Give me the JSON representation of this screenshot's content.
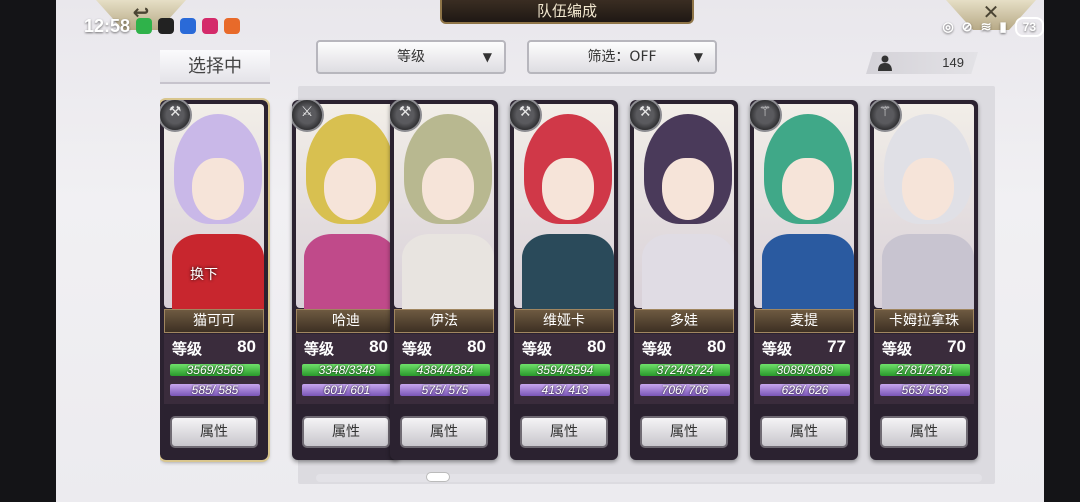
{
  "status_bar": {
    "time": "12:58",
    "battery": "73"
  },
  "header": {
    "title": "队伍编成"
  },
  "selecting_label": "选择中",
  "sort_dropdown": {
    "value": "等级"
  },
  "filter_dropdown": {
    "value": "筛选：OFF"
  },
  "unit_count": "149",
  "swap_label": "换下",
  "level_label": "等级",
  "attr_button_label": "属性",
  "cards": [
    {
      "name": "猫可可",
      "level": "80",
      "hp": "3569/3569",
      "mp": "585/ 585",
      "weapon_icon": "axe-icon",
      "hair": "#c9b8e8",
      "outfit": "#c8262e"
    },
    {
      "name": "哈迪",
      "level": "80",
      "hp": "3348/3348",
      "mp": "601/ 601",
      "weapon_icon": "sword-icon",
      "hair": "#d8c050",
      "outfit": "#c04a8a"
    },
    {
      "name": "伊法",
      "level": "80",
      "hp": "4384/4384",
      "mp": "575/ 575",
      "weapon_icon": "hammer-icon",
      "hair": "#b8b890",
      "outfit": "#e8e4e0"
    },
    {
      "name": "维娅卡",
      "level": "80",
      "hp": "3594/3594",
      "mp": "413/ 413",
      "weapon_icon": "hammer-icon",
      "hair": "#d03848",
      "outfit": "#2a4a5a"
    },
    {
      "name": "多娃",
      "level": "80",
      "hp": "3724/3724",
      "mp": "706/ 706",
      "weapon_icon": "hammer-icon",
      "hair": "#4a3a5a",
      "outfit": "#e0dce4"
    },
    {
      "name": "麦提",
      "level": "77",
      "hp": "3089/3089",
      "mp": "626/ 626",
      "weapon_icon": "staff-icon",
      "hair": "#40a888",
      "outfit": "#2a5aa0"
    },
    {
      "name": "卡姆拉拿珠",
      "level": "70",
      "hp": "2781/2781",
      "mp": "563/ 563",
      "weapon_icon": "staff-icon",
      "hair": "#e0e0e6",
      "outfit": "#c8c4d0"
    }
  ]
}
